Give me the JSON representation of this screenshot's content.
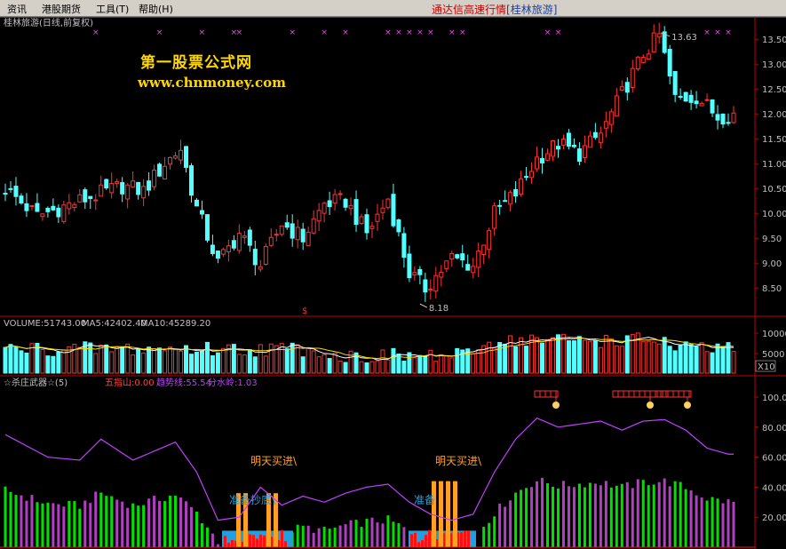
{
  "menu": {
    "items": [
      "资讯",
      "港股期货",
      "工具(T)",
      "帮助(H)"
    ],
    "title_prefix": "通达信高速行情",
    "title_stock": "[桂林旅游]"
  },
  "kline_panel": {
    "label": "桂林旅游(日线,前复权)",
    "high_marker": "13.63",
    "low_marker": "8.18",
    "split_marker": "$",
    "y_ticks": [
      "13.50",
      "13.00",
      "12.50",
      "12.00",
      "11.50",
      "11.00",
      "10.50",
      "10.00",
      "9.50",
      "9.00",
      "8.50"
    ]
  },
  "volume_panel": {
    "label": "VOLUME:51743.00",
    "ma5": "MA5:42402.40",
    "ma10": "MA10:45289.20",
    "y_ticks": [
      "10000",
      "5000"
    ],
    "unit": "X10"
  },
  "indicator_panel": {
    "name": "☆杀庄武器☆(5)",
    "val1": "五指山:0.00",
    "val2": "趋势线:55.54",
    "val3": "分水岭:1.03",
    "y_ticks": [
      "100.00",
      "80.00",
      "60.00",
      "40.00",
      "20.00"
    ],
    "signal_buy_tomorrow": "明天买进\\",
    "signal_prepare": "准备抄底\\",
    "signal_prepare_short": "准备"
  },
  "watermark": {
    "line1": "第一股票公式网",
    "line2": "www.chnmoney.com"
  },
  "colors": {
    "up": "#ff3232",
    "down": "#54ffff",
    "background": "#000000",
    "grid": "#c00000",
    "trend": "#c040ff",
    "bar_green": "#00e000",
    "bar_purple": "#b040c0",
    "signal_orange": "#ffa020",
    "signal_blue": "#20a0e0"
  },
  "chart_data": {
    "type": "candlestick",
    "high": 13.63,
    "low": 8.18,
    "price_range": [
      8.2,
      13.7
    ]
  }
}
